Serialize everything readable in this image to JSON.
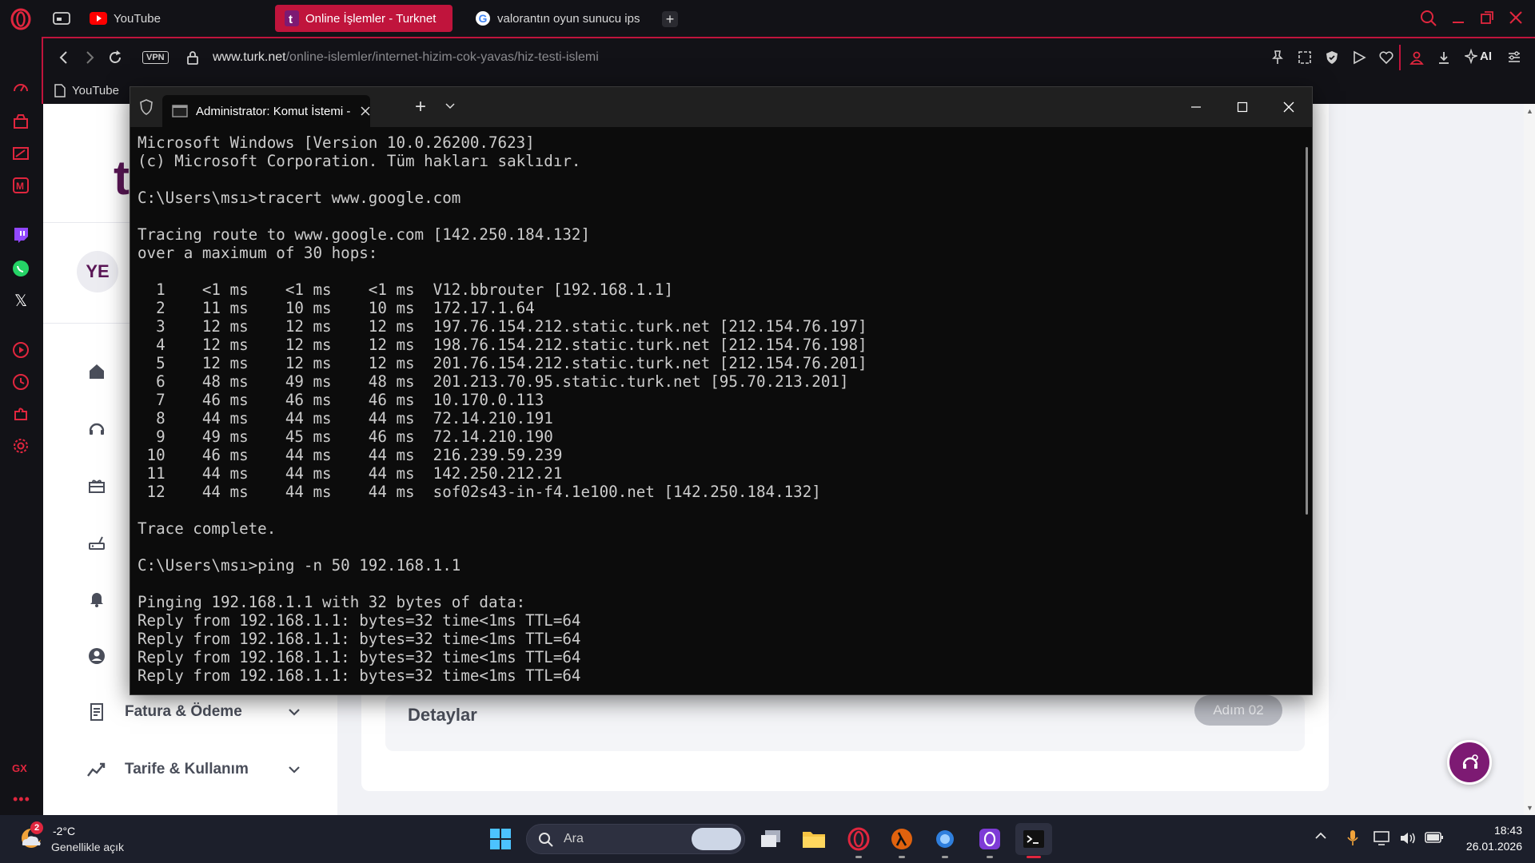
{
  "browser": {
    "tabs": [
      {
        "label": "YouTube"
      },
      {
        "label": "Online İşlemler - Turknet"
      },
      {
        "label": "valorantın oyun sunucu ips"
      }
    ],
    "vpn_label": "VPN",
    "url_domain": "www.turk.net",
    "url_path": "/online-islemler/internet-hizim-cok-yavas/hiz-testi-islemi",
    "ai_label": "AI",
    "bookmark": "YouTube",
    "gx_label": "GX"
  },
  "page": {
    "avatar": "YE",
    "nav": [
      {
        "label": "Fatura & Ödeme"
      },
      {
        "label": "Tarife & Kullanım"
      }
    ],
    "details_title": "Detaylar",
    "step_badge": "Adım 02"
  },
  "terminal": {
    "tab_title": "Administrator: Komut İstemi -",
    "lines": [
      "Microsoft Windows [Version 10.0.26200.7623]",
      "(c) Microsoft Corporation. Tüm hakları saklıdır.",
      "",
      "C:\\Users\\msı>tracert www.google.com",
      "",
      "Tracing route to www.google.com [142.250.184.132]",
      "over a maximum of 30 hops:",
      "",
      "  1    <1 ms    <1 ms    <1 ms  V12.bbrouter [192.168.1.1]",
      "  2    11 ms    10 ms    10 ms  172.17.1.64",
      "  3    12 ms    12 ms    12 ms  197.76.154.212.static.turk.net [212.154.76.197]",
      "  4    12 ms    12 ms    12 ms  198.76.154.212.static.turk.net [212.154.76.198]",
      "  5    12 ms    12 ms    12 ms  201.76.154.212.static.turk.net [212.154.76.201]",
      "  6    48 ms    49 ms    48 ms  201.213.70.95.static.turk.net [95.70.213.201]",
      "  7    46 ms    46 ms    46 ms  10.170.0.113",
      "  8    44 ms    44 ms    44 ms  72.14.210.191",
      "  9    49 ms    45 ms    46 ms  72.14.210.190",
      " 10    46 ms    44 ms    44 ms  216.239.59.239",
      " 11    44 ms    44 ms    44 ms  142.250.212.21",
      " 12    44 ms    44 ms    44 ms  sof02s43-in-f4.1e100.net [142.250.184.132]",
      "",
      "Trace complete.",
      "",
      "C:\\Users\\msı>ping -n 50 192.168.1.1",
      "",
      "Pinging 192.168.1.1 with 32 bytes of data:",
      "Reply from 192.168.1.1: bytes=32 time<1ms TTL=64",
      "Reply from 192.168.1.1: bytes=32 time<1ms TTL=64",
      "Reply from 192.168.1.1: bytes=32 time<1ms TTL=64",
      "Reply from 192.168.1.1: bytes=32 time<1ms TTL=64"
    ]
  },
  "taskbar": {
    "weather_badge": "2",
    "weather_temp": "-2°C",
    "weather_desc": "Genellikle açık",
    "search_placeholder": "Ara",
    "time": "18:43",
    "date": "26.01.2026"
  },
  "colors": {
    "accent": "#c0143c",
    "brand": "#7d1a73"
  }
}
